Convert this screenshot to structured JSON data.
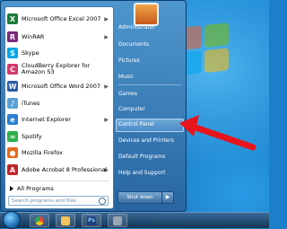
{
  "start_menu": {
    "pinned_programs": [
      {
        "label": "Microsoft Office Excel 2007",
        "icon": "excel-icon",
        "color": "#1e7b3b",
        "glyph": "X",
        "submenu": true
      },
      {
        "label": "WinRAR",
        "icon": "winrar-icon",
        "color": "#7a2a7a",
        "glyph": "R",
        "submenu": true
      },
      {
        "label": "Skype",
        "icon": "skype-icon",
        "color": "#00a6e8",
        "glyph": "S",
        "submenu": false
      },
      {
        "label": "CloudBerry Explorer for Amazon S3",
        "icon": "cloudberry-icon",
        "color": "#d23a6a",
        "glyph": "C",
        "submenu": false
      },
      {
        "label": "Microsoft Office Word 2007",
        "icon": "word-icon",
        "color": "#2b5aa8",
        "glyph": "W",
        "submenu": true
      },
      {
        "label": "iTunes",
        "icon": "itunes-icon",
        "color": "#5aa0d8",
        "glyph": "♪",
        "submenu": false
      },
      {
        "label": "Internet Explorer",
        "icon": "internet-explorer-icon",
        "color": "#2f7fd0",
        "glyph": "e",
        "submenu": true
      },
      {
        "label": "Spotify",
        "icon": "spotify-icon",
        "color": "#2fb24a",
        "glyph": "≈",
        "submenu": false
      },
      {
        "label": "Mozilla Firefox",
        "icon": "firefox-icon",
        "color": "#e36b1c",
        "glyph": "●",
        "submenu": false
      },
      {
        "label": "Adobe Acrobat 8 Professional",
        "icon": "acrobat-icon",
        "color": "#c0262d",
        "glyph": "A",
        "submenu": true
      }
    ],
    "all_programs": "All Programs",
    "search_placeholder": "Search programs and files",
    "right_pane": {
      "items": [
        "Administrator",
        "Documents",
        "Pictures",
        "Music",
        "Games",
        "Computer",
        "Control Panel",
        "Devices and Printers",
        "Default Programs",
        "Help and Support"
      ]
    },
    "shutdown_label": "Shut down",
    "shutdown_arrow": "▶"
  },
  "taskbar": {
    "pinned": [
      {
        "icon": "chrome-icon",
        "color": "#e8443a"
      },
      {
        "icon": "file-explorer-icon",
        "color": "#f2c45a"
      },
      {
        "icon": "photoshop-icon",
        "color": "#1f3f7a",
        "glyph": "Ps"
      },
      {
        "icon": "remote-tool-icon",
        "color": "#9aa7b3"
      }
    ]
  },
  "annotation": {
    "arrow_color": "#e8141b"
  }
}
